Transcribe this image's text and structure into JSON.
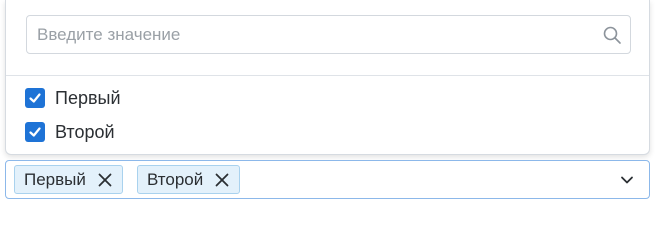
{
  "search": {
    "placeholder": "Введите значение",
    "icon": "search-icon"
  },
  "options": [
    {
      "label": "Первый",
      "checked": true
    },
    {
      "label": "Второй",
      "checked": true
    }
  ],
  "selected_chips": [
    {
      "label": "Первый",
      "remove_icon": "close-icon"
    },
    {
      "label": "Второй",
      "remove_icon": "close-icon"
    }
  ],
  "select": {
    "toggle_icon": "chevron-down-icon"
  },
  "colors": {
    "accent": "#1e73d6",
    "chip_background": "#e3f1fb",
    "chip_border": "#a9d2ee",
    "field_focus_border": "#8cb8ea"
  }
}
